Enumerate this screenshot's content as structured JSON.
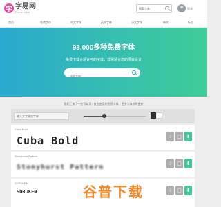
{
  "header": {
    "logo_mark": "字",
    "logo_name": "字易网",
    "logo_domain": "Fontzi.com",
    "search_placeholder": "搜索字体",
    "user_label": "登录"
  },
  "nav": {
    "items": [
      {
        "label": "首页"
      },
      {
        "label": "免费字体"
      },
      {
        "label": "中文字体"
      },
      {
        "label": "英文字体"
      },
      {
        "label": "日文字体"
      },
      {
        "label": "韩文"
      },
      {
        "label": "标志"
      }
    ]
  },
  "hero": {
    "title": "93,000多种免费字体",
    "subtitle": "免费下载合适许可的字体，非常适合您的项目设计",
    "search_placeholder": "搜索字体"
  },
  "intro": "我们汇集了一些可商用 / 自由使用的免费字体，更多字体即将更新",
  "toolbar": {
    "preview_placeholder": "输入文字预览字体",
    "size_fraction": 0.33
  },
  "fonts": [
    {
      "name": "Cuba Bold",
      "sample": "Cuba Bold",
      "style": "heavy"
    },
    {
      "name": "Stonyhurst Pattern",
      "sample": "Stonyhurst Pattern",
      "style": "blur"
    },
    {
      "name": "SURUKEN",
      "sample": "SURUKEN",
      "style": "small"
    }
  ],
  "buttons": {
    "fav": "☆",
    "view": "▢",
    "dl": "⬇"
  },
  "watermark": "谷普下载",
  "colors": {
    "brand": "#e14f9c",
    "hero_start": "#2aa9cf",
    "hero_end": "#3fcc98",
    "download": "#47c39d",
    "watermark": "#f08a2a"
  }
}
